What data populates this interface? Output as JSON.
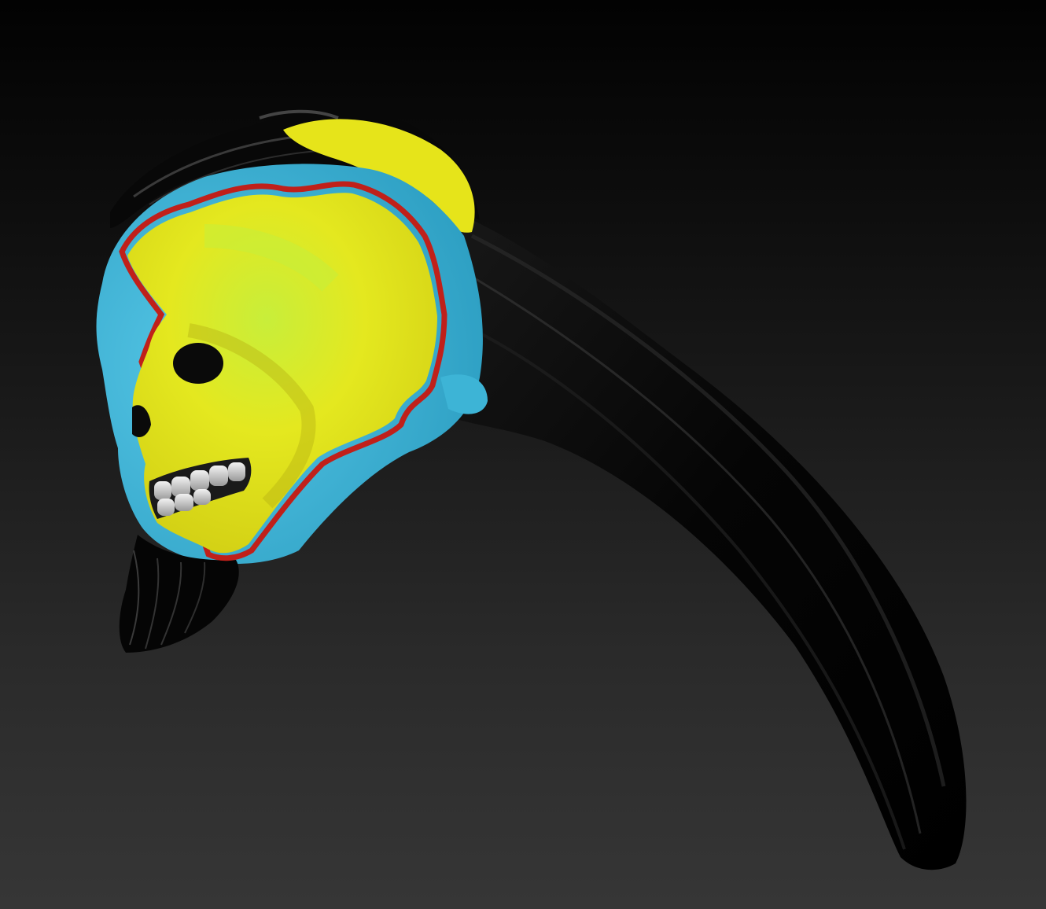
{
  "viewport": {
    "background_color_top": "#030303",
    "background_color_bottom": "#363636"
  },
  "model": {
    "subject": "skull-sculpt",
    "colors": {
      "bone": "#e6e81e",
      "bone_highlight": "#c6f040",
      "masked_region": "#3db4d6",
      "mask_edge": "#c0201a",
      "hair": "#050505",
      "teeth": "#e4e4e4"
    }
  }
}
